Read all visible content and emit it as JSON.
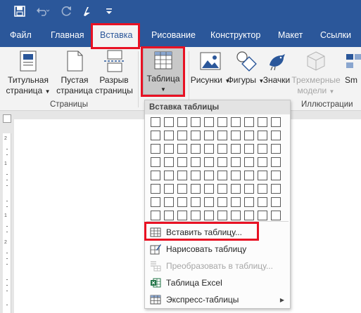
{
  "qat": {
    "items": [
      {
        "name": "save-icon"
      },
      {
        "name": "undo-icon"
      },
      {
        "name": "redo-icon"
      },
      {
        "name": "format-painter-icon"
      },
      {
        "name": "customize-qat-icon"
      }
    ]
  },
  "tabs": [
    {
      "label": "Файл"
    },
    {
      "label": "Главная"
    },
    {
      "label": "Вставка",
      "active": true
    },
    {
      "label": "Рисование"
    },
    {
      "label": "Конструктор"
    },
    {
      "label": "Макет"
    },
    {
      "label": "Ссылки"
    }
  ],
  "ribbon": {
    "pages_group": {
      "label": "Страницы",
      "cover_page": {
        "line1": "Титульная",
        "line2": "страница"
      },
      "blank_page": {
        "line1": "Пустая",
        "line2": "страница"
      },
      "page_break": {
        "line1": "Разрыв",
        "line2": "страницы"
      }
    },
    "table_button": {
      "label": "Таблица"
    },
    "illustrations_group": {
      "label": "Иллюстрации",
      "pictures": {
        "label": "Рисунки"
      },
      "shapes": {
        "label": "Фигуры"
      },
      "icons": {
        "label": "Значки"
      },
      "models": {
        "line1": "Трехмерные",
        "line2": "модели"
      },
      "smartart": {
        "label": "Sm"
      }
    }
  },
  "dropdown": {
    "header": "Вставка таблицы",
    "grid": {
      "columns": 10,
      "rows": 8
    },
    "items": [
      {
        "label": "Вставить таблицу...",
        "icon": "insert-table-icon",
        "enabled": true
      },
      {
        "label": "Нарисовать таблицу",
        "icon": "draw-table-icon",
        "enabled": true
      },
      {
        "label": "Преобразовать в таблицу...",
        "icon": "convert-to-table-icon",
        "enabled": false
      },
      {
        "label": "Таблица Excel",
        "icon": "excel-icon",
        "enabled": true
      },
      {
        "label": "Экспресс-таблицы",
        "icon": "quick-tables-icon",
        "enabled": true,
        "submenu": true
      }
    ]
  },
  "ruler": {
    "numbers": [
      "2",
      "1",
      "1",
      "2"
    ]
  },
  "colors": {
    "title_bar": "#2b579a",
    "ribbon": "#f3f3f3",
    "highlight": "#e81123",
    "disabled_text": "#a6a6a6",
    "excel_green": "#217346"
  }
}
